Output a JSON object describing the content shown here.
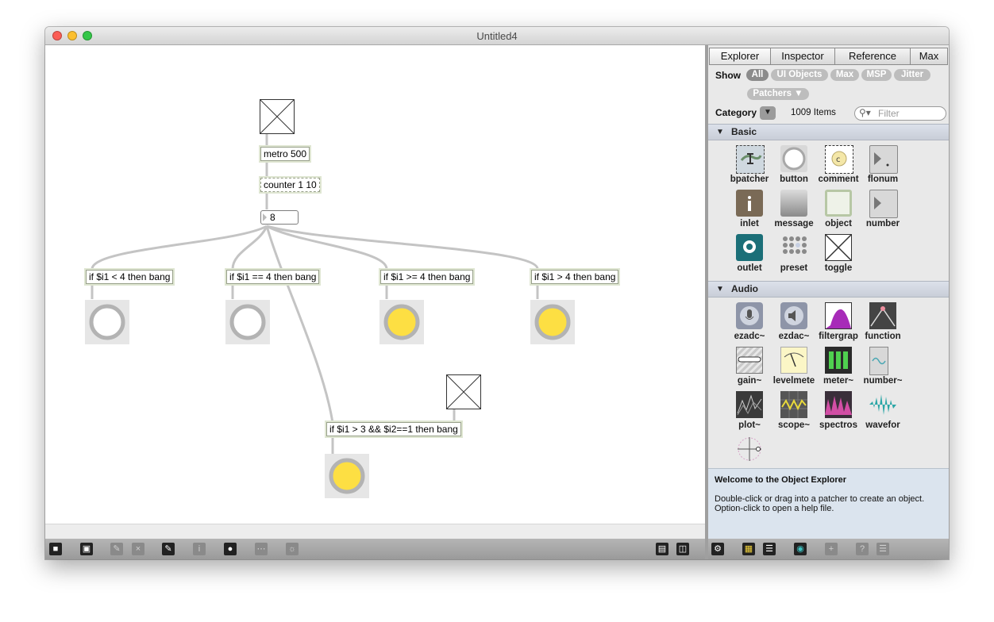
{
  "window": {
    "title": "Untitled4"
  },
  "patcher": {
    "objects": {
      "metro": "metro 500",
      "counter": "counter 1 10",
      "number": "8",
      "if1": "if $i1 < 4 then bang",
      "if2": "if $i1 == 4 then bang",
      "if3": "if $i1 >= 4 then bang",
      "if4": "if $i1 > 4 then bang",
      "if5": "if $i1 > 3 && $i2==1 then bang"
    },
    "bangs": {
      "bang1": "off",
      "bang2": "off",
      "bang3": "on",
      "bang4": "on",
      "bang5": "on"
    },
    "colors": {
      "bang_on": "#fddf43",
      "bang_ring": "#b3b3b3",
      "box_border": "#dfe6d2"
    }
  },
  "sidebar": {
    "tabs": [
      "Explorer",
      "Inspector",
      "Reference",
      "Max"
    ],
    "show_label": "Show",
    "show_filters": [
      "All",
      "UI Objects",
      "Max",
      "MSP",
      "Jitter"
    ],
    "patchers_filter": "Patchers ▼",
    "category_label": "Category",
    "category_dropdown": "▼",
    "item_count": "1009 Items",
    "filter_placeholder": "Filter",
    "sections": {
      "basic": {
        "title": "Basic",
        "items": [
          "bpatcher",
          "button",
          "comment",
          "flonum",
          "inlet",
          "message",
          "object",
          "number",
          "outlet",
          "preset",
          "toggle"
        ]
      },
      "audio": {
        "title": "Audio",
        "items": [
          "ezadc~",
          "ezdac~",
          "filtergrap",
          "function",
          "gain~",
          "levelmete",
          "meter~",
          "number~",
          "plot~",
          "scope~",
          "spectros",
          "wavefor"
        ]
      }
    },
    "info": {
      "title": "Welcome to the Object Explorer",
      "line1": "Double-click or drag into a patcher to create an object.",
      "line2": "Option-click to open a help file."
    }
  },
  "icons": {
    "toolbar": [
      "lock-icon",
      "presentation-icon",
      "paint-icon",
      "clear-icon",
      "debug-icon",
      "info-icon",
      "connect-icon",
      "grid-icon",
      "snap-icon",
      "layout-one-icon",
      "layout-two-icon"
    ],
    "sidebar": [
      "gear-icon",
      "grid-view-icon",
      "list-view-icon",
      "eye-icon",
      "add-icon",
      "help-icon",
      "menu-icon"
    ]
  }
}
